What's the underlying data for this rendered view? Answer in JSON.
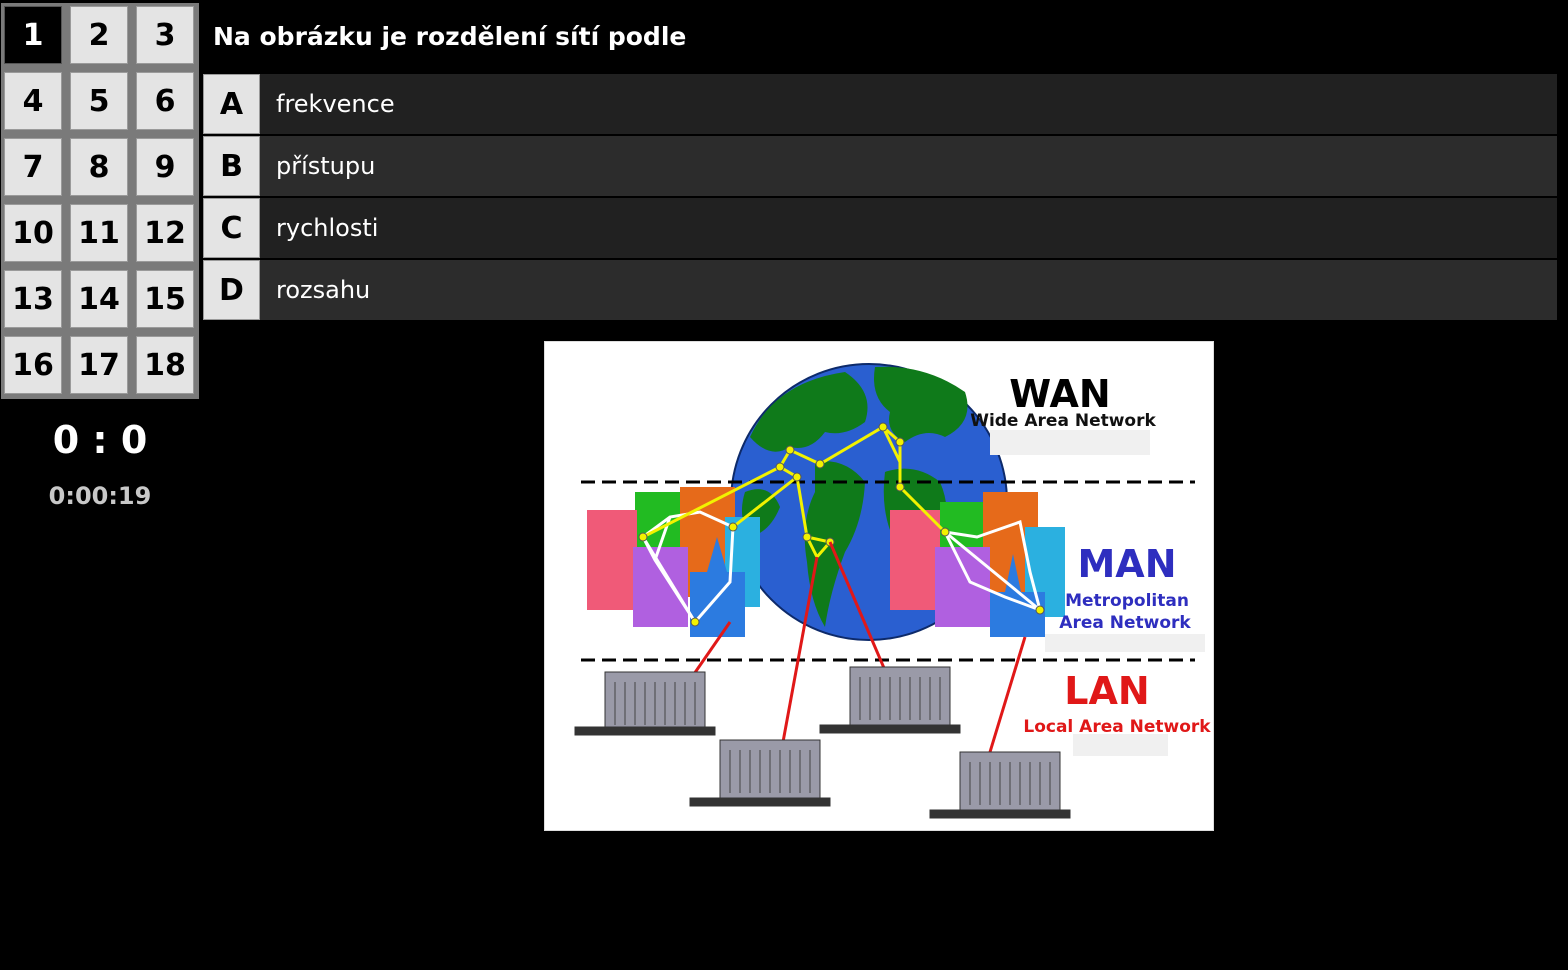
{
  "grid": {
    "cells": [
      "1",
      "2",
      "3",
      "4",
      "5",
      "6",
      "7",
      "8",
      "9",
      "10",
      "11",
      "12",
      "13",
      "14",
      "15",
      "16",
      "17",
      "18"
    ],
    "active_index": 0
  },
  "score": "0 : 0",
  "timer": "0:00:19",
  "question": "Na obrázku je rozdělení sítí podle",
  "answers": [
    {
      "letter": "A",
      "text": "frekvence"
    },
    {
      "letter": "B",
      "text": "přístupu"
    },
    {
      "letter": "C",
      "text": "rychlosti"
    },
    {
      "letter": "D",
      "text": "rozsahu"
    }
  ],
  "figure": {
    "wan_title": "WAN",
    "wan_sub": "Wide Area Network",
    "man_title": "MAN",
    "man_sub1": "Metropolitan",
    "man_sub2": "Area Network",
    "lan_title": "LAN",
    "lan_sub": "Local  Area Network",
    "colors": {
      "wan": "#000000",
      "man": "#2e2ebf",
      "lan": "#e01818",
      "ocean": "#2a5fd0",
      "land": "#0f7a1a",
      "wan_links": "#f2f200",
      "lan_links": "#e01818"
    }
  }
}
